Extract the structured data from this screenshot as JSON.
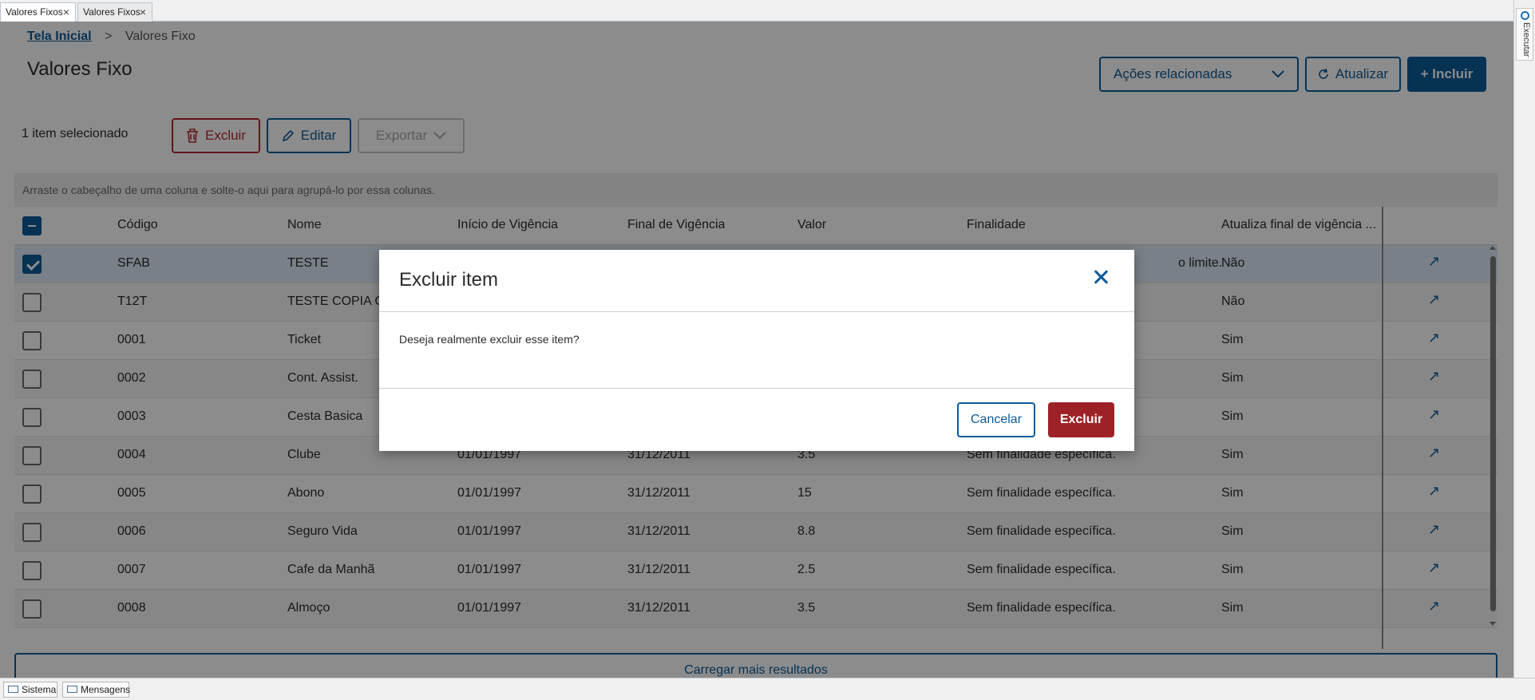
{
  "window_tabs": [
    {
      "label": "Valores Fixos"
    },
    {
      "label": "Valores Fixos"
    }
  ],
  "sidebar": {
    "execute_label": "Executar"
  },
  "breadcrumb": {
    "home": "Tela Inicial",
    "separator": ">",
    "current": "Valores Fixo"
  },
  "page_title": "Valores Fixo",
  "header_actions": {
    "related_actions": "Ações relacionadas",
    "refresh": "Atualizar",
    "include": "+ Incluir"
  },
  "selection_bar": {
    "count_label": "1 item selecionado",
    "delete": "Excluir",
    "edit": "Editar",
    "export": "Exportar"
  },
  "grid": {
    "group_hint": "Arraste o cabeçalho de uma coluna e solte-o aqui para agrupá-lo por essa colunas.",
    "columns": [
      "Código",
      "Nome",
      "Início de Vigência",
      "Final de Vigência",
      "Valor",
      "Finalidade",
      "Atualiza final de vigência ..."
    ],
    "rows": [
      {
        "codigo": "SFAB",
        "nome": "TESTE",
        "inicio": "",
        "final": "",
        "valor": "",
        "finalidade": "o limite.",
        "atualiza": "Não",
        "selected": true
      },
      {
        "codigo": "T12T",
        "nome": "TESTE COPIA C",
        "inicio": "",
        "final": "",
        "valor": "",
        "finalidade": "",
        "atualiza": "Não",
        "selected": false
      },
      {
        "codigo": "0001",
        "nome": "Ticket",
        "inicio": "",
        "final": "",
        "valor": "",
        "finalidade": "",
        "atualiza": "Sim",
        "selected": false
      },
      {
        "codigo": "0002",
        "nome": "Cont. Assist.",
        "inicio": "",
        "final": "",
        "valor": "",
        "finalidade": "",
        "atualiza": "Sim",
        "selected": false
      },
      {
        "codigo": "0003",
        "nome": "Cesta Basica",
        "inicio": "",
        "final": "",
        "valor": "",
        "finalidade": "",
        "atualiza": "Sim",
        "selected": false
      },
      {
        "codigo": "0004",
        "nome": "Clube",
        "inicio": "01/01/1997",
        "final": "31/12/2011",
        "valor": "3.5",
        "finalidade": "Sem finalidade específica.",
        "atualiza": "Sim",
        "selected": false
      },
      {
        "codigo": "0005",
        "nome": "Abono",
        "inicio": "01/01/1997",
        "final": "31/12/2011",
        "valor": "15",
        "finalidade": "Sem finalidade específica.",
        "atualiza": "Sim",
        "selected": false
      },
      {
        "codigo": "0006",
        "nome": "Seguro Vida",
        "inicio": "01/01/1997",
        "final": "31/12/2011",
        "valor": "8.8",
        "finalidade": "Sem finalidade específica.",
        "atualiza": "Sim",
        "selected": false
      },
      {
        "codigo": "0007",
        "nome": "Cafe da Manhã",
        "inicio": "01/01/1997",
        "final": "31/12/2011",
        "valor": "2.5",
        "finalidade": "Sem finalidade específica.",
        "atualiza": "Sim",
        "selected": false
      },
      {
        "codigo": "0008",
        "nome": "Almoço",
        "inicio": "01/01/1997",
        "final": "31/12/2011",
        "valor": "3.5",
        "finalidade": "Sem finalidade específica.",
        "atualiza": "Sim",
        "selected": false
      }
    ],
    "row_action_icon": "open-in-new-icon",
    "load_more": "Carregar mais resultados"
  },
  "statusbar": {
    "system": "Sistema",
    "messages": "Mensagens"
  },
  "modal": {
    "title": "Excluir item",
    "body": "Deseja realmente excluir esse item?",
    "cancel": "Cancelar",
    "confirm": "Excluir"
  },
  "colors": {
    "primary": "#0c5b99",
    "danger": "#9d2227",
    "overlay": "rgba(0,0,0,0.45)"
  }
}
